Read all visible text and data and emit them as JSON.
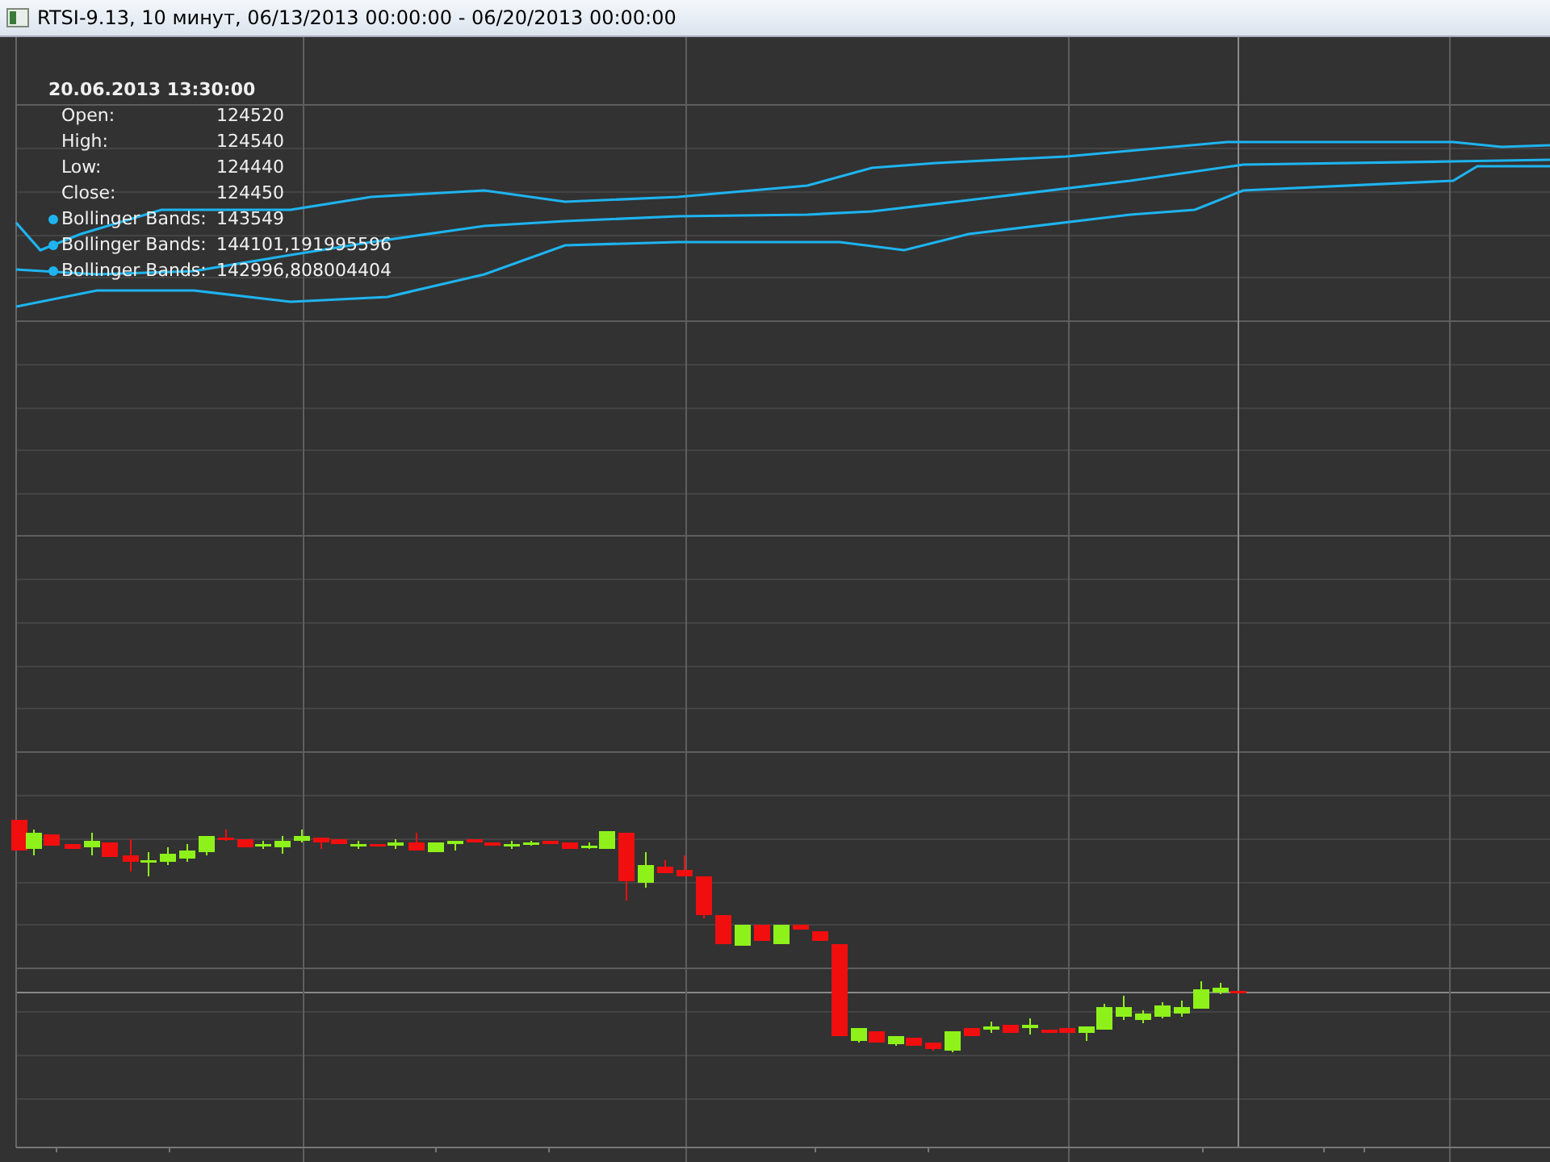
{
  "window": {
    "title": "RTSI-9.13, 10 минут, 06/13/2013 00:00:00 - 06/20/2013 00:00:00"
  },
  "legend": {
    "timestamp": "20.06.2013 13:30:00",
    "rows": [
      {
        "kind": "price",
        "label": "Open:",
        "value": "124520"
      },
      {
        "kind": "price",
        "label": "High:",
        "value": "124540"
      },
      {
        "kind": "price",
        "label": "Low:",
        "value": "124440"
      },
      {
        "kind": "price",
        "label": "Close:",
        "value": "124450"
      },
      {
        "kind": "indicator",
        "label": "Bollinger Bands:",
        "value": "143549",
        "color": "#1eb4f0"
      },
      {
        "kind": "indicator",
        "label": "Bollinger Bands:",
        "value": "144101,191995596",
        "color": "#1eb4f0"
      },
      {
        "kind": "indicator",
        "label": "Bollinger Bands:",
        "value": "142996,808004404",
        "color": "#1eb4f0"
      }
    ]
  }
}
